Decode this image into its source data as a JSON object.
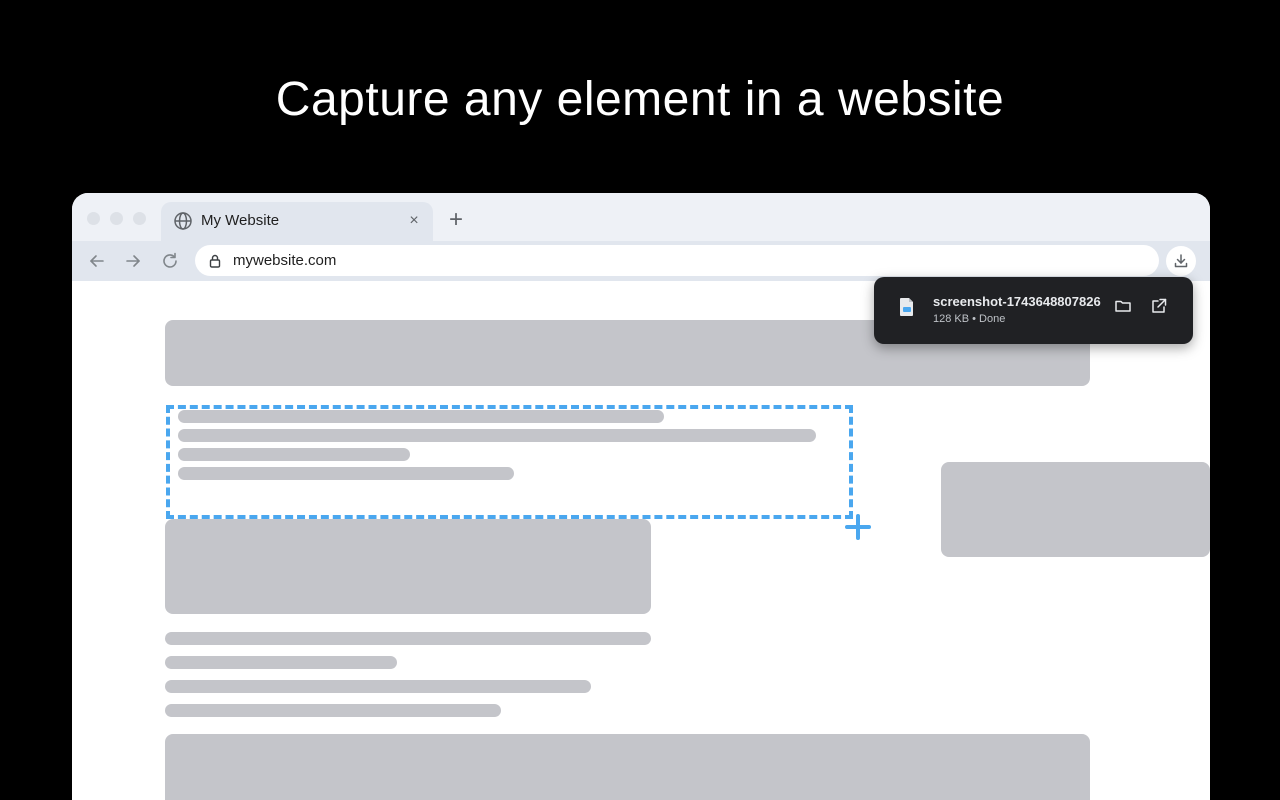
{
  "headline": "Capture any element in a website",
  "browser": {
    "tab": {
      "title": "My Website",
      "close_glyph": "×"
    },
    "new_tab_glyph": "+",
    "address_bar": {
      "url": "mywebsite.com"
    }
  },
  "download": {
    "file_name": "screenshot-1743648807826",
    "meta": "128 KB • Done"
  },
  "colors": {
    "selection_accent": "#4aa7ef",
    "placeholder_block": "#c4c5ca",
    "popup_background": "#202124"
  },
  "icons": {
    "tab": "globe-icon",
    "close": "close-icon",
    "new_tab": "plus-icon",
    "back": "arrow-left-icon",
    "forward": "arrow-right-icon",
    "reload": "reload-icon",
    "secure": "lock-icon",
    "download": "download-icon",
    "file": "file-icon",
    "open_folder": "folder-icon",
    "open_external": "external-link-icon",
    "selection_cursor": "crosshair-plus-icon"
  }
}
